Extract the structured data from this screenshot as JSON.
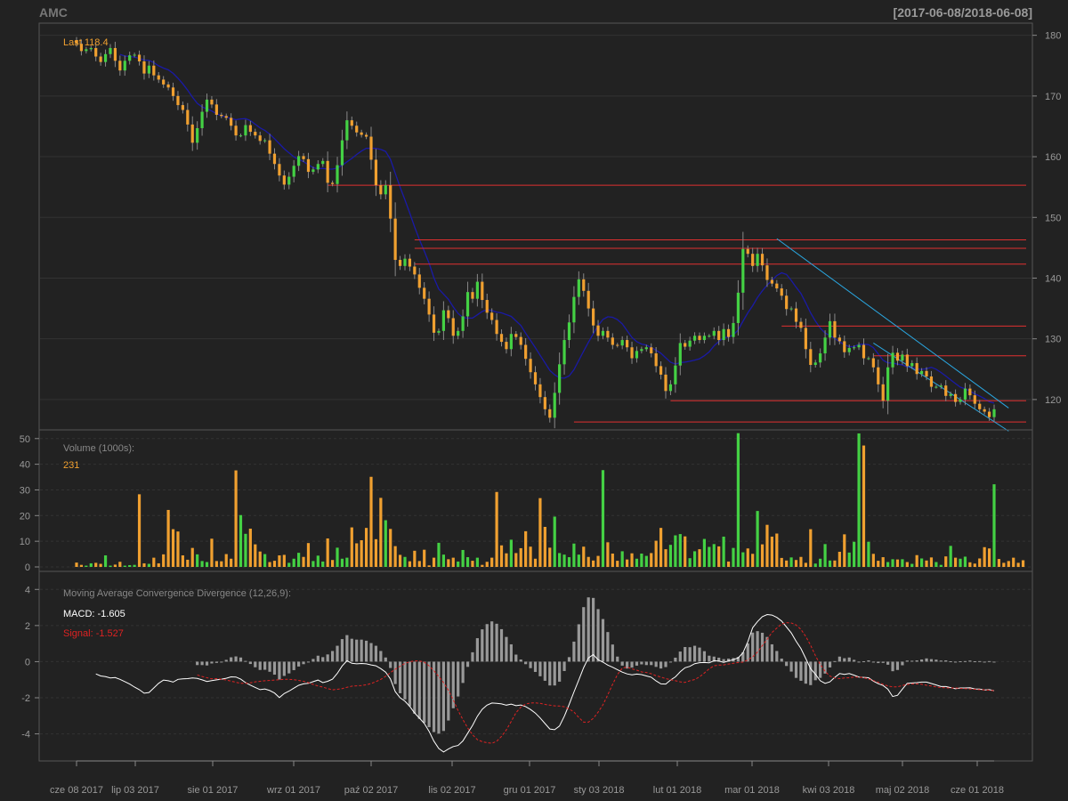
{
  "header": {
    "symbol": "AMC",
    "range": "[2017-06-08/2018-06-08]"
  },
  "colors": {
    "background": "#222222",
    "grid": "#333333",
    "frame": "#555555",
    "axis_text": "#999999",
    "up": "#44d144",
    "down": "#f0a030",
    "moving_average": "#1a1aa6",
    "support_resistance": "#e03030",
    "trend_channel": "#2aa6e0",
    "macd": "#ffffff",
    "signal": "#dd2222",
    "histogram": "#999999"
  },
  "chart_data": [
    {
      "type": "candlestick",
      "panel": "price",
      "legend_text": "Last 118.4",
      "ylim": [
        115,
        182
      ],
      "yticks": [
        120,
        130,
        140,
        150,
        160,
        170,
        180
      ],
      "grid": true,
      "x_tick_labels": [
        "cze 08 2017",
        "lip 03 2017",
        "sie 01 2017",
        "wrz 01 2017",
        "paź 02 2017",
        "lis 02 2017",
        "gru 01 2017",
        "sty 03 2018",
        "lut 01 2018",
        "mar 01 2018",
        "kwi 03 2018",
        "maj 02 2018",
        "cze 01 2018"
      ],
      "closes": [
        178.6,
        177.4,
        177.7,
        177.9,
        176.5,
        175.6,
        176.9,
        177.9,
        175.8,
        174.2,
        175.8,
        176.7,
        176.8,
        175.7,
        173.7,
        175.0,
        173.4,
        172.7,
        171.9,
        171.4,
        170.0,
        168.5,
        167.7,
        165.3,
        162.3,
        164.7,
        167.4,
        169.4,
        168.6,
        166.9,
        166.7,
        166.4,
        165.1,
        163.5,
        163.5,
        165.2,
        164.1,
        163.5,
        162.6,
        162.7,
        160.5,
        158.8,
        156.9,
        155.4,
        156.7,
        158.5,
        160.1,
        159.6,
        157.5,
        157.9,
        158.8,
        159.3,
        155.7,
        155.5,
        158.6,
        162.7,
        166.0,
        165.1,
        164.0,
        163.6,
        163.3,
        159.5,
        155.3,
        153.8,
        155.3,
        149.8,
        143.0,
        142.0,
        143.2,
        141.9,
        140.6,
        138.4,
        136.6,
        134.0,
        131.0,
        131.3,
        134.7,
        133.4,
        130.5,
        131.3,
        133.7,
        137.7,
        136.6,
        139.4,
        136.4,
        134.3,
        133.1,
        130.8,
        129.5,
        128.3,
        130.8,
        130.3,
        129.0,
        126.7,
        124.5,
        122.5,
        120.4,
        118.4,
        117.0,
        121.1,
        125.8,
        129.8,
        132.7,
        136.9,
        139.8,
        137.9,
        135.0,
        132.2,
        130.5,
        131.3,
        130.2,
        129.0,
        128.9,
        129.8,
        128.6,
        126.8,
        128.0,
        128.3,
        128.6,
        127.6,
        125.5,
        124.1,
        121.4,
        122.5,
        125.6,
        129.3,
        128.7,
        129.7,
        130.5,
        129.8,
        130.5,
        130.5,
        131.3,
        129.8,
        131.6,
        130.3,
        132.6,
        137.6,
        144.8,
        144.0,
        142.0,
        144.0,
        142.1,
        139.7,
        139.1,
        138.3,
        137.1,
        134.9,
        135.0,
        132.8,
        131.8,
        128.3,
        125.7,
        126.1,
        127.6,
        130.2,
        132.9,
        130.2,
        129.6,
        127.8,
        128.5,
        128.6,
        129.0,
        126.8,
        126.8,
        125.3,
        122.5,
        119.8,
        125.3,
        127.7,
        126.4,
        127.4,
        125.5,
        126.0,
        124.2,
        124.7,
        123.8,
        122.1,
        122.1,
        122.3,
        120.6,
        120.9,
        119.6,
        120.0,
        121.8,
        120.7,
        119.3,
        118.4,
        118.0,
        117.1,
        118.4
      ]
    },
    {
      "type": "bar",
      "panel": "volume",
      "title": "Volume (1000s):",
      "last_label": "231",
      "ylim": [
        0,
        52
      ],
      "yticks": [
        0,
        10,
        20,
        30,
        40,
        50
      ],
      "values": [
        1.7,
        0.8,
        0.5,
        1.4,
        1.6,
        1.2,
        4.5,
        0.5,
        0.9,
        2.0,
        0.5,
        0.7,
        0.8,
        28.3,
        1.4,
        1.2,
        3.6,
        1.4,
        4.9,
        22.2,
        14.7,
        13.8,
        4.5,
        2.8,
        7.4,
        4.9,
        2.3,
        1.9,
        11.0,
        2.3,
        2.2,
        5.0,
        3.2,
        37.6,
        20.2,
        12.9,
        14.9,
        8.8,
        6.0,
        5.0,
        1.9,
        2.4,
        4.5,
        4.7,
        1.6,
        3.2,
        5.5,
        3.9,
        9.3,
        2.3,
        4.4,
        2.1,
        11.1,
        2.7,
        7.5,
        3.2,
        3.6,
        15.4,
        9.2,
        10.4,
        15.2,
        35.1,
        10.8,
        26.9,
        18.2,
        14.8,
        8.1,
        4.7,
        3.9,
        2.2,
        6.3,
        2.3,
        6.7,
        0.6,
        3.6,
        9.4,
        4.8,
        3.0,
        3.6,
        2.1,
        6.6,
        3.8,
        2.4,
        3.6,
        0.8,
        2.0,
        3.6,
        29.2,
        8.4,
        5.3,
        10.6,
        5.4,
        7.3,
        13.9,
        7.9,
        3.2,
        26.8,
        15.6,
        7.5,
        19.6,
        5.4,
        4.8,
        3.8,
        9.1,
        4.8,
        7.9,
        3.9,
        2.5,
        4.3,
        37.7,
        9.6,
        5.2,
        2.4,
        6.1,
        2.9,
        5.3,
        3.2,
        5.2,
        4.3,
        5.4,
        10.2,
        15.2,
        6.9,
        8.6,
        12.3,
        12.8,
        11.9,
        3.4,
        6.1,
        6.9,
        10.9,
        7.8,
        8.9,
        8.0,
        11.8,
        2.1,
        7.4,
        52.1,
        5.7,
        7.2,
        5.1,
        21.8,
        8.8,
        16.4,
        11.8,
        13.0,
        3.5,
        2.5,
        3.7,
        2.7,
        3.9,
        1.6,
        14.7,
        1.3,
        3.2,
        8.9,
        2.5,
        2.5,
        5.9,
        12.7,
        5.6,
        9.8,
        52.0,
        47.3,
        9.8,
        5.1,
        2.4,
        3.8,
        1.9,
        3.0,
        2.9,
        3.0,
        1.9,
        1.2,
        4.6,
        3.3,
        2.5,
        3.7,
        1.9,
        0.8,
        4.1,
        8.2,
        3.6,
        3.2,
        4.0,
        1.8,
        1.3,
        3.3,
        7.7,
        7.2,
        32.2,
        3.1,
        1.6,
        2.3,
        3.6,
        1.6,
        2.6
      ]
    },
    {
      "type": "line",
      "panel": "macd",
      "title": "Moving Average Convergence Divergence (12,26,9):",
      "macd_label": "MACD: -1.605",
      "signal_label": "Signal: -1.527",
      "ylim": [
        -5.5,
        5.0
      ],
      "yticks": [
        -4,
        -2,
        0,
        2,
        4
      ],
      "series": [
        {
          "name": "MACD",
          "values": [
            -0.68,
            -0.79,
            -0.83,
            -0.9,
            -0.88,
            -0.98,
            -1.11,
            -1.24,
            -1.41,
            -1.55,
            -1.75,
            -1.71,
            -1.46,
            -1.2,
            -1.02,
            -1.06,
            -1.13,
            -0.98,
            -0.95,
            -0.94,
            -0.9,
            -0.93,
            -1.01,
            -1.1,
            -1.05,
            -1.01,
            -0.97,
            -0.92,
            -0.84,
            -0.85,
            -0.97,
            -1.16,
            -1.3,
            -1.43,
            -1.55,
            -1.51,
            -1.6,
            -1.74,
            -1.99,
            -1.77,
            -1.63,
            -1.47,
            -1.31,
            -1.23,
            -1.2,
            -1.11,
            -1.02,
            -1.16,
            -1.09,
            -0.97,
            -0.65,
            -0.24,
            0.05,
            -0.09,
            -0.12,
            -0.1,
            -0.12,
            -0.18,
            -0.23,
            -0.39,
            -0.58,
            -0.96,
            -1.66,
            -2.0,
            -2.19,
            -2.48,
            -2.84,
            -3.13,
            -3.42,
            -3.86,
            -4.4,
            -4.81,
            -5.0,
            -4.84,
            -4.7,
            -4.64,
            -4.39,
            -3.96,
            -3.53,
            -3.02,
            -2.64,
            -2.41,
            -2.29,
            -2.31,
            -2.34,
            -2.41,
            -2.35,
            -2.44,
            -2.4,
            -2.49,
            -2.65,
            -2.85,
            -3.12,
            -3.43,
            -3.73,
            -3.77,
            -3.57,
            -3.02,
            -2.37,
            -1.68,
            -1.02,
            -0.33,
            0.21,
            0.39,
            0.11,
            -0.03,
            -0.19,
            -0.31,
            -0.44,
            -0.58,
            -0.68,
            -0.73,
            -0.69,
            -0.72,
            -0.79,
            -0.86,
            -1.07,
            -1.23,
            -1.24,
            -1.02,
            -0.84,
            -0.56,
            -0.34,
            -0.26,
            -0.11,
            -0.06,
            -0.05,
            -0.07,
            0.05,
            0.03,
            -0.04,
            0.04,
            0.11,
            0.21,
            0.49,
            1.11,
            1.88,
            2.22,
            2.49,
            2.61,
            2.58,
            2.45,
            2.25,
            1.92,
            1.59,
            1.13,
            0.73,
            0.17,
            -0.39,
            -0.7,
            -1.06,
            -1.2,
            -1.12,
            -0.87,
            -0.66,
            -0.71,
            -0.66,
            -0.75,
            -0.85,
            -0.87,
            -0.89,
            -1.08,
            -1.22,
            -1.32,
            -1.52,
            -1.93,
            -1.86,
            -1.52,
            -1.2,
            -1.18,
            -1.16,
            -1.13,
            -1.13,
            -1.21,
            -1.29,
            -1.38,
            -1.38,
            -1.44,
            -1.5,
            -1.46,
            -1.46,
            -1.45,
            -1.51,
            -1.52,
            -1.57,
            -1.55,
            -1.61
          ]
        },
        {
          "name": "Signal",
          "values": [
            -0.74,
            -0.82,
            -0.89,
            -0.95,
            -0.94,
            -0.97,
            -1.02,
            -1.08,
            -1.14,
            -1.2,
            -1.2,
            -1.17,
            -1.12,
            -1.09,
            -1.06,
            -1.04,
            -1.02,
            -1.0,
            -0.98,
            -0.98,
            -1.0,
            -1.04,
            -1.09,
            -1.16,
            -1.26,
            -1.35,
            -1.41,
            -1.49,
            -1.56,
            -1.53,
            -1.49,
            -1.42,
            -1.36,
            -1.34,
            -1.32,
            -1.28,
            -1.21,
            -1.11,
            -0.98,
            -0.81,
            -0.61,
            -0.42,
            -0.25,
            -0.1,
            -0.01,
            0.04,
            0.04,
            -0.03,
            -0.23,
            -0.5,
            -0.82,
            -1.16,
            -1.58,
            -2.12,
            -2.71,
            -3.21,
            -3.67,
            -4.05,
            -4.32,
            -4.43,
            -4.49,
            -4.52,
            -4.41,
            -4.14,
            -3.78,
            -3.31,
            -2.83,
            -2.52,
            -2.35,
            -2.29,
            -2.28,
            -2.31,
            -2.37,
            -2.41,
            -2.45,
            -2.46,
            -2.5,
            -2.62,
            -2.79,
            -3.09,
            -3.35,
            -3.35,
            -3.14,
            -2.8,
            -2.39,
            -1.83,
            -1.26,
            -0.72,
            -0.36,
            -0.3,
            -0.4,
            -0.47,
            -0.57,
            -0.6,
            -0.67,
            -0.78,
            -0.85,
            -0.94,
            -1.0,
            -1.06,
            -1.12,
            -1.15,
            -1.06,
            -0.99,
            -0.84,
            -0.63,
            -0.4,
            -0.23,
            -0.19,
            -0.18,
            -0.13,
            -0.09,
            -0.05,
            -0.03,
            0.1,
            0.27,
            0.53,
            0.89,
            1.24,
            1.62,
            1.86,
            2.08,
            2.16,
            2.14,
            2.03,
            1.79,
            1.39,
            0.91,
            0.33,
            -0.16,
            -0.54,
            -0.8,
            -0.9,
            -0.94,
            -0.9,
            -0.89,
            -0.85,
            -0.85,
            -0.89,
            -0.96,
            -1.05,
            -1.14,
            -1.25,
            -1.35,
            -1.4,
            -1.4,
            -1.32,
            -1.26,
            -1.23,
            -1.23,
            -1.25,
            -1.31,
            -1.35,
            -1.4,
            -1.44,
            -1.45,
            -1.46,
            -1.46,
            -1.48,
            -1.49,
            -1.51,
            -1.53,
            -1.55,
            -1.56,
            -1.58,
            -1.61
          ]
        }
      ]
    }
  ]
}
